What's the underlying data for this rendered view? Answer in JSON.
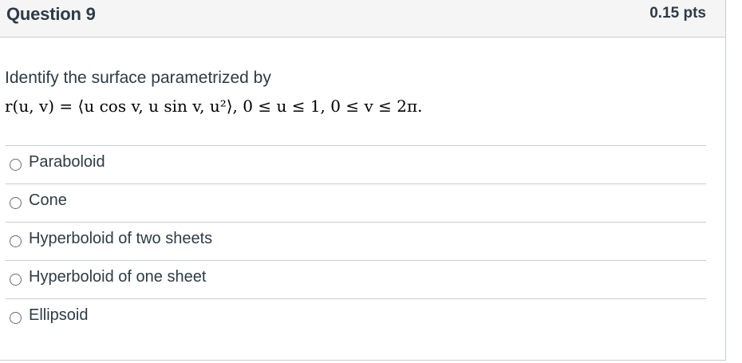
{
  "question": {
    "title": "Question 9",
    "points": "0.15 pts",
    "prompt": "Identify the surface parametrized by",
    "formula": "r(u, v) = ⟨u cos v, u sin v, u²⟩, 0 ≤ u ≤ 1, 0 ≤ v ≤ 2π."
  },
  "answers": [
    {
      "label": "Paraboloid"
    },
    {
      "label": "Cone"
    },
    {
      "label": "Hyperboloid of two sheets"
    },
    {
      "label": "Hyperboloid of one sheet"
    },
    {
      "label": "Ellipsoid"
    }
  ]
}
